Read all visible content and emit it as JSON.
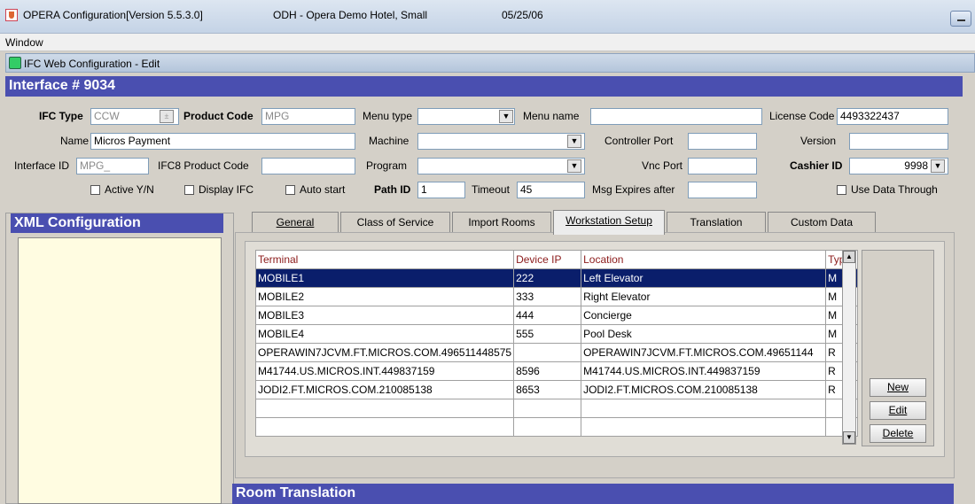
{
  "titlebar": {
    "app_title": "OPERA Configuration[Version 5.5.3.0]",
    "hotel": "ODH - Opera Demo Hotel, Small",
    "date": "05/25/06"
  },
  "menu": {
    "window": "Window"
  },
  "subwindow": {
    "title": "IFC Web Configuration - Edit"
  },
  "interface_header": "Interface # 9034",
  "form": {
    "ifc_type_label": "IFC Type",
    "ifc_type_value": "CCW",
    "product_code_label": "Product Code",
    "product_code_value": "MPG",
    "menu_type_label": "Menu type",
    "menu_type_value": "",
    "menu_name_label": "Menu name",
    "menu_name_value": "",
    "license_code_label": "License Code",
    "license_code_value": "4493322437",
    "name_label": "Name",
    "name_value": "Micros Payment",
    "machine_label": "Machine",
    "machine_value": "",
    "controller_port_label": "Controller Port",
    "controller_port_value": "",
    "version_label": "Version",
    "version_value": "",
    "interface_id_label": "Interface ID",
    "interface_id_value": "MPG_",
    "ifc8_label": "IFC8 Product Code",
    "ifc8_value": "",
    "program_label": "Program",
    "program_value": "",
    "vnc_port_label": "Vnc Port",
    "vnc_port_value": "",
    "cashier_id_label": "Cashier ID",
    "cashier_id_value": "9998",
    "active_label": "Active Y/N",
    "display_ifc_label": "Display IFC",
    "auto_start_label": "Auto start",
    "path_id_label": "Path ID",
    "path_id_value": "1",
    "timeout_label": "Timeout",
    "timeout_value": "45",
    "msg_expires_label": "Msg Expires after",
    "msg_expires_value": "",
    "use_data_through_label": "Use Data Through"
  },
  "xml_header": "XML Configuration",
  "tabs": [
    {
      "label": "General"
    },
    {
      "label": "Class of Service"
    },
    {
      "label": "Import Rooms"
    },
    {
      "label": "Workstation Setup"
    },
    {
      "label": "Translation"
    },
    {
      "label": "Custom Data"
    }
  ],
  "grid": {
    "headers": [
      "Terminal",
      "Device IP",
      "Location",
      "Type"
    ],
    "rows": [
      [
        "MOBILE1",
        "222",
        "Left Elevator",
        "M"
      ],
      [
        "MOBILE2",
        "333",
        "Right Elevator",
        "M"
      ],
      [
        "MOBILE3",
        "444",
        "Concierge",
        "M"
      ],
      [
        "MOBILE4",
        "555",
        "Pool Desk",
        "M"
      ],
      [
        "OPERAWIN7JCVM.FT.MICROS.COM.496511448575",
        "",
        "OPERAWIN7JCVM.FT.MICROS.COM.49651144",
        "R"
      ],
      [
        "M41744.US.MICROS.INT.449837159",
        "8596",
        "M41744.US.MICROS.INT.449837159",
        "R"
      ],
      [
        "JODI2.FT.MICROS.COM.210085138",
        "8653",
        "JODI2.FT.MICROS.COM.210085138",
        "R"
      ],
      [
        "",
        "",
        "",
        ""
      ],
      [
        "",
        "",
        "",
        ""
      ]
    ]
  },
  "buttons": {
    "new": "New",
    "edit": "Edit",
    "delete": "Delete"
  },
  "room_translation_header": "Room Translation"
}
